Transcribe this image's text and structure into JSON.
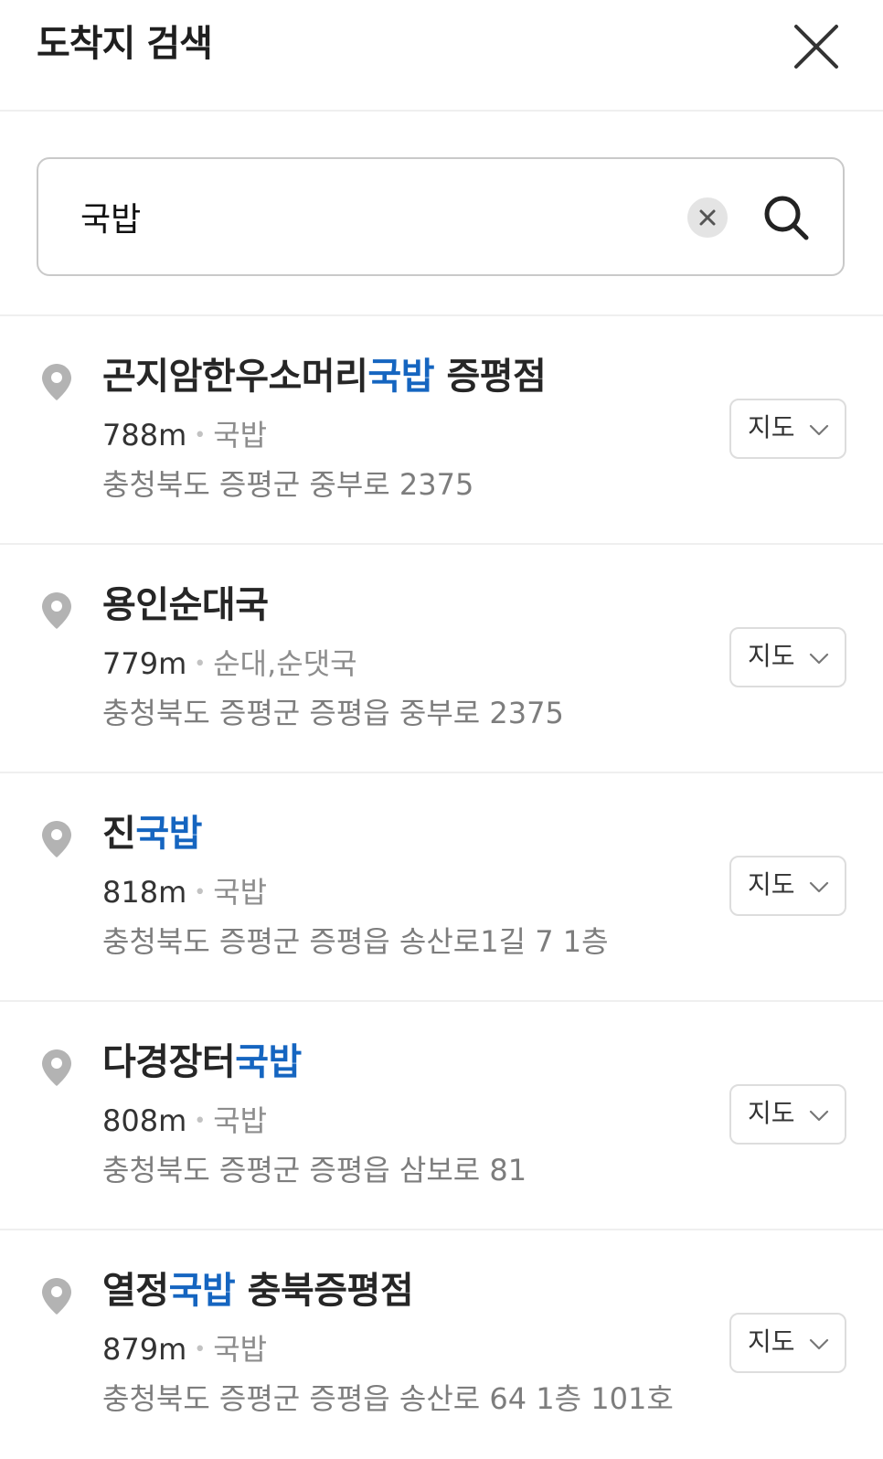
{
  "header": {
    "title": "도착지 검색"
  },
  "search": {
    "value": "국밥",
    "placeholder": ""
  },
  "colors": {
    "highlight": "#1565c0",
    "pin": "#b3b3b3",
    "divider": "#efefef"
  },
  "results": [
    {
      "name_parts": [
        {
          "text": "곤지암한우소머리",
          "highlight": false
        },
        {
          "text": "국밥",
          "highlight": true
        },
        {
          "text": " 증평점",
          "highlight": false
        }
      ],
      "distance": "788m",
      "separator": "•",
      "category": "국밥",
      "address": "충청북도 증평군 중부로 2375",
      "map_label": "지도"
    },
    {
      "name_parts": [
        {
          "text": "용인순대국",
          "highlight": false
        }
      ],
      "distance": "779m",
      "separator": "•",
      "category": "순대,순댓국",
      "address": "충청북도 증평군 증평읍 중부로 2375",
      "map_label": "지도"
    },
    {
      "name_parts": [
        {
          "text": "진",
          "highlight": false
        },
        {
          "text": "국밥",
          "highlight": true
        }
      ],
      "distance": "818m",
      "separator": "•",
      "category": "국밥",
      "address": "충청북도 증평군 증평읍 송산로1길 7 1층",
      "map_label": "지도"
    },
    {
      "name_parts": [
        {
          "text": "다경장터",
          "highlight": false
        },
        {
          "text": "국밥",
          "highlight": true
        }
      ],
      "distance": "808m",
      "separator": "•",
      "category": "국밥",
      "address": "충청북도 증평군 증평읍 삼보로 81",
      "map_label": "지도"
    },
    {
      "name_parts": [
        {
          "text": "열정",
          "highlight": false
        },
        {
          "text": "국밥",
          "highlight": true
        },
        {
          "text": " 충북증평점",
          "highlight": false
        }
      ],
      "distance": "879m",
      "separator": "•",
      "category": "국밥",
      "address": "충청북도 증평군 증평읍 송산로 64 1층 101호",
      "map_label": "지도"
    }
  ]
}
